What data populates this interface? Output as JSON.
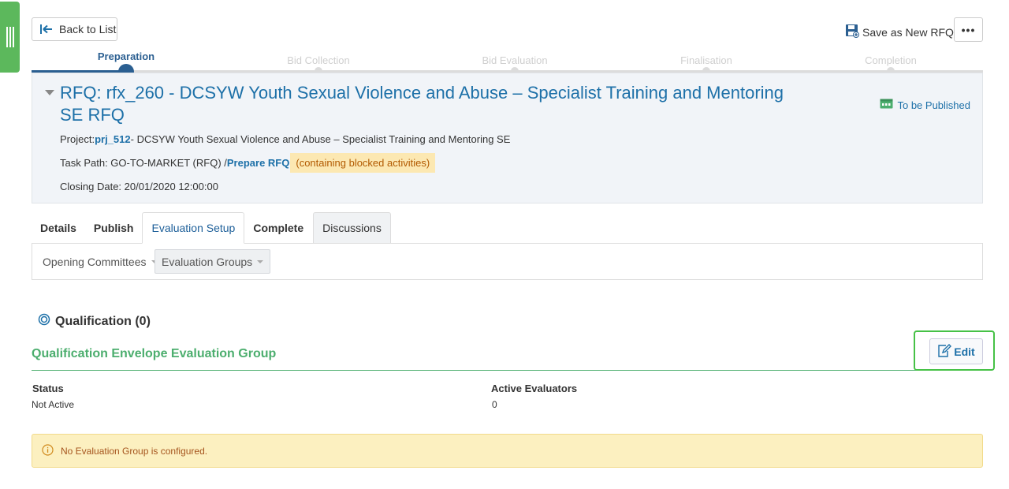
{
  "toolbar": {
    "back_label": "Back to List",
    "save_new_label": "Save as New RFQ",
    "more_label": "•••"
  },
  "stepper": {
    "steps": [
      "Preparation",
      "Bid Collection",
      "Bid Evaluation",
      "Finalisation",
      "Completion"
    ],
    "active": "Preparation"
  },
  "rfq": {
    "title": "RFQ: rfx_260 - DCSYW Youth Sexual Violence and Abuse – Specialist Training and Mentoring SE RFQ",
    "status": "To be Published",
    "project_label": "Project:",
    "project_id": "prj_512",
    "project_name": "- DCSYW Youth Sexual Violence and Abuse – Specialist Training and Mentoring SE",
    "task_path_label": "Task Path: GO-TO-MARKET (RFQ) /",
    "task_path_link": "Prepare RFQ",
    "blocked_note": "(containing blocked activities)",
    "closing_date": "Closing Date: 20/01/2020 12:00:00"
  },
  "tabs": [
    "Details",
    "Publish",
    "Evaluation Setup",
    "Complete",
    "Discussions"
  ],
  "subtabs": [
    "Opening Committees",
    "Evaluation Groups"
  ],
  "qualification": {
    "heading": "Qualification (0)",
    "group_title": "Qualification Envelope Evaluation Group",
    "edit_label": "Edit",
    "status_label": "Status",
    "status_value": "Not Active",
    "evaluators_label": "Active Evaluators",
    "evaluators_value": "0"
  },
  "alert": {
    "message": "No Evaluation Group is configured."
  },
  "colors": {
    "accent": "#1d70a8",
    "success": "#4cae6e",
    "side_tab": "#5cb85c",
    "warning_bg": "#fcf0c0"
  }
}
